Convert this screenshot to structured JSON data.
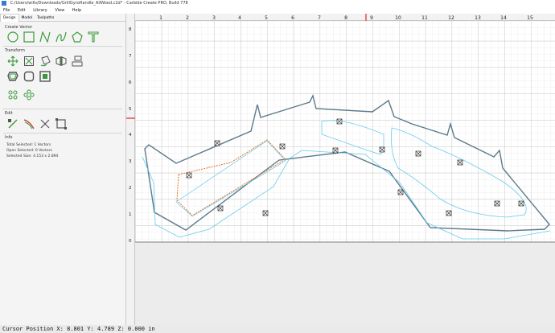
{
  "window": {
    "title": "C:/Users/wills/Downloads/GrillGyroHandle_AllWood.c2d* - Carbide Create PRO, Build 778"
  },
  "menu": {
    "items": [
      "File",
      "Edit",
      "Library",
      "View",
      "Help"
    ]
  },
  "panel": {
    "tabs": [
      "Design",
      "Model",
      "Toolpaths"
    ],
    "sections": {
      "create_vector": "Create Vector",
      "transform": "Transform",
      "edit": "Edit",
      "info": "Info"
    },
    "info_lines": [
      "Total Selected: 1 Vectors",
      "Open Selected: 0 Vectors",
      "Selected Size: 4.153 x 2.894"
    ]
  },
  "ruler": {
    "x_labels": [
      "1",
      "2",
      "3",
      "4",
      "5",
      "6",
      "7",
      "8",
      "9",
      "10",
      "11",
      "12",
      "13",
      "14",
      "15"
    ],
    "y_labels": [
      "8",
      "7",
      "6",
      "5",
      "4",
      "3",
      "2",
      "1",
      "0"
    ]
  },
  "status": {
    "text": "Cursor Position X: 8.801 Y: 4.789 Z: 0.000 in"
  },
  "colors": {
    "accent_green": "#3a9a3a",
    "outline_gray": "#5c7a8a",
    "offset_cyan": "#66ccee",
    "selection_orange": "#e8732a",
    "cursor_marker": "#e84040"
  }
}
